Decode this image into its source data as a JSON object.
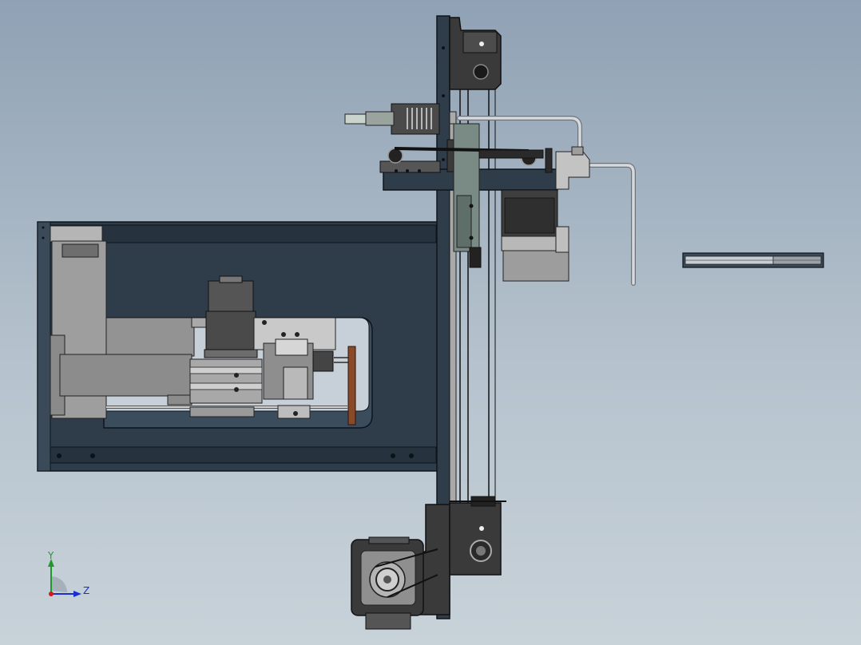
{
  "triad": {
    "y_label": "Y",
    "z_label": "Z",
    "colors": {
      "y": "#1e9a2a",
      "z": "#1a2fd0",
      "x": "#d01a1a"
    }
  },
  "colors": {
    "frame_dark": "#2c3a48",
    "frame_edge": "#111820",
    "plate_gray": "#7c7c7c",
    "light_gray": "#bdbdbd",
    "motor_dark": "#4b4b4b",
    "copper": "#8a4a2a",
    "tube": "#c9cdd1"
  }
}
